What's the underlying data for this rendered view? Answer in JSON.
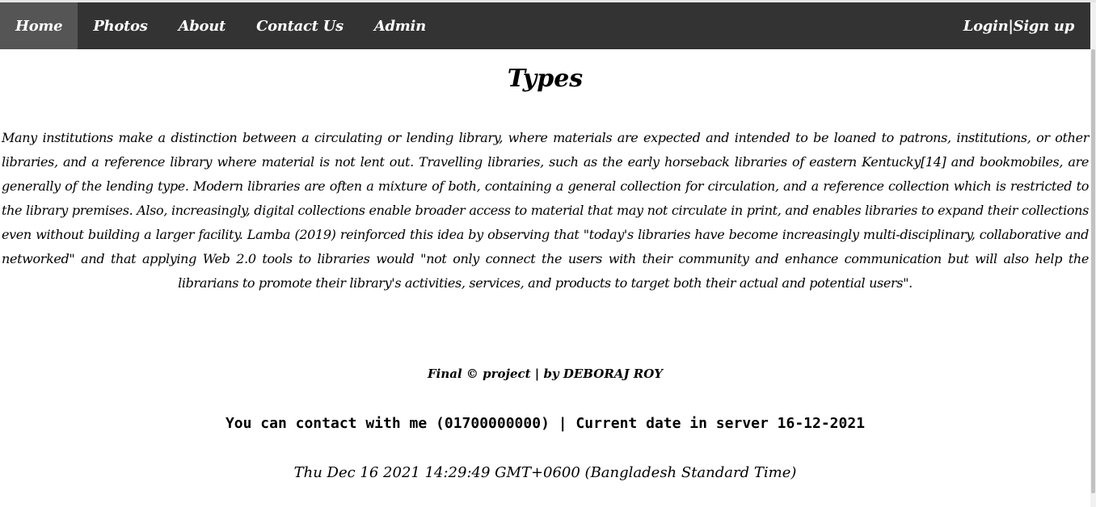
{
  "nav": {
    "items": [
      {
        "label": "Home",
        "active": true
      },
      {
        "label": "Photos",
        "active": false
      },
      {
        "label": "About",
        "active": false
      },
      {
        "label": "Contact Us",
        "active": false
      },
      {
        "label": "Admin",
        "active": false
      }
    ],
    "login_label": "Login|Sign up"
  },
  "content": {
    "title": "Types",
    "paragraph": "Many institutions make a distinction between a circulating or lending library, where materials are expected and intended to be loaned to patrons, institutions, or other libraries, and a reference library where material is not lent out. Travelling libraries, such as the early horseback libraries of eastern Kentucky[14] and bookmobiles, are generally of the lending type. Modern libraries are often a mixture of both, containing a general collection for circulation, and a reference collection which is restricted to the library premises. Also, increasingly, digital collections enable broader access to material that may not circulate in print, and enables libraries to expand their collections even without building a larger facility. Lamba (2019) reinforced this idea by observing that \"today's libraries have become increasingly multi-disciplinary, collaborative and networked\" and that applying Web 2.0 tools to libraries would \"not only connect the users with their community and enhance communication but will also help the librarians to promote their library's activities, services, and products to target both their actual and potential users\"."
  },
  "footer": {
    "credit": "Final © project | by DEBORAJ ROY",
    "contact": "You can contact with me (01700000000) | Current date in server 16-12-2021",
    "client_date": "Thu Dec 16 2021 14:29:49 GMT+0600 (Bangladesh Standard Time)"
  },
  "colors": {
    "navbar_bg": "#333333",
    "nav_active_bg": "#555555",
    "nav_text": "#ffffff",
    "page_bg": "#ffffff",
    "text": "#000000"
  }
}
